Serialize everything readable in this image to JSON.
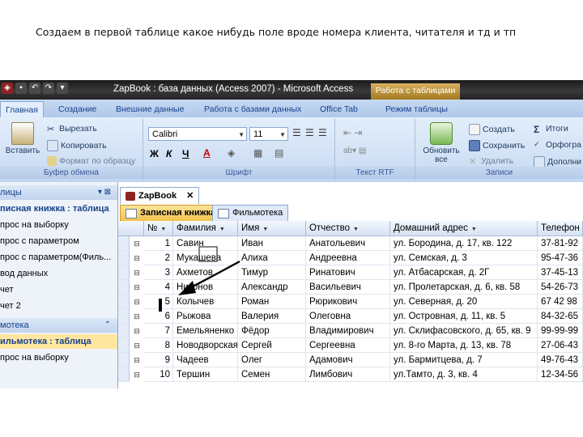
{
  "caption": "Создаем в первой таблице какое нибудь поле вроде номера клиента, читателя и тд и тп",
  "window": {
    "title": "ZapBook : база данных (Access 2007) - Microsoft Access",
    "context_tab": "Работа с таблицами"
  },
  "ribbon_tabs": [
    "Главная",
    "Создание",
    "Внешние данные",
    "Работа с базами данных",
    "Office Tab",
    "Режим таблицы"
  ],
  "ribbon": {
    "clipboard": {
      "paste": "Вставить",
      "cut": "Вырезать",
      "copy": "Копировать",
      "format_painter": "Формат по образцу",
      "label": "Буфер обмена"
    },
    "font": {
      "name": "Calibri",
      "size": "11",
      "label": "Шрифт"
    },
    "rich_text": {
      "label": "Текст RTF"
    },
    "records": {
      "refresh": "Обновить все",
      "new": "Создать",
      "save": "Сохранить",
      "delete": "Удалить",
      "totals": "Итоги",
      "spelling": "Орфогра",
      "more": "Дополни",
      "label": "Записи"
    }
  },
  "nav": {
    "group1_header": "лицы",
    "group1_items": [
      "писная книжка : таблица",
      "прос на выборку",
      "прос с параметром",
      "прос с параметром(Филь...",
      "вод данных",
      "чет",
      "чет 2"
    ],
    "group2_header": "мотека",
    "group2_items": [
      "ильмотека : таблица",
      "прос на выборку"
    ]
  },
  "doc_tab": "ZapBook",
  "object_tabs": [
    "Записная книжка",
    "Фильмотека"
  ],
  "grid": {
    "columns": [
      "№",
      "Фамилия",
      "Имя",
      "Отчество",
      "Домашний адрес",
      "Телефон"
    ],
    "rows": [
      [
        "1",
        "Савин",
        "Иван",
        "Анатольевич",
        "ул. Бородина, д. 17, кв. 122",
        "37-81-92"
      ],
      [
        "2",
        "Мукашева",
        "Алиха",
        "Андреевна",
        "ул. Семская, д. 3",
        "95-47-36"
      ],
      [
        "3",
        "Ахметов",
        "Тимур",
        "Ринатович",
        "ул. Атбасарская, д. 2Г",
        "37-45-13"
      ],
      [
        "4",
        "Никонов",
        "Александр",
        "Васильевич",
        "ул. Пролетарская, д. 6, кв. 58",
        "54-26-73"
      ],
      [
        "5",
        "Колычев",
        "Роман",
        "Рюрикович",
        "ул. Северная, д. 20",
        "67 42 98"
      ],
      [
        "6",
        "Рыжова",
        "Валерия",
        "Олеговна",
        "ул. Островная, д. 11, кв. 5",
        "84-32-65"
      ],
      [
        "7",
        "Емельяненко",
        "Фёдор",
        "Владимирович",
        "ул. Склифасовского, д. 65, кв. 9",
        "99-99-99"
      ],
      [
        "8",
        "Новодворская",
        "Сергей",
        "Сергеевна",
        "ул. 8-го Марта, д. 13, кв. 78",
        "27-06-43"
      ],
      [
        "9",
        "Чадеев",
        "Олег",
        "Адамович",
        "ул. Бармитцева, д. 7",
        "49-76-43"
      ],
      [
        "10",
        "Тершин",
        "Семен",
        "Лимбович",
        "ул.Тамто, д. 3, кв. 4",
        "12-34-56"
      ]
    ]
  },
  "colors": {
    "ribbon_bg": "#cfdff4",
    "title_bg": "#2a2a2a",
    "accent": "#15428b",
    "active_tab": "#f4c24c",
    "arrow": "#000000"
  }
}
